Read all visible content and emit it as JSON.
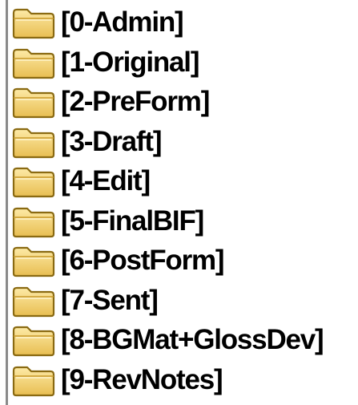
{
  "folder_tree": {
    "icon": "folder-icon",
    "colors": {
      "folder_fill": "#f5d77e",
      "folder_outline": "#8a6a12",
      "tree_line": "#8a8a8a",
      "label": "#000000"
    },
    "items": [
      {
        "label": "[0-Admin]"
      },
      {
        "label": "[1-Original]"
      },
      {
        "label": "[2-PreForm]"
      },
      {
        "label": "[3-Draft]"
      },
      {
        "label": "[4-Edit]"
      },
      {
        "label": "[5-FinalBIF]"
      },
      {
        "label": "[6-PostForm]"
      },
      {
        "label": "[7-Sent]"
      },
      {
        "label": "[8-BGMat+GlossDev]"
      },
      {
        "label": "[9-RevNotes]"
      }
    ]
  }
}
